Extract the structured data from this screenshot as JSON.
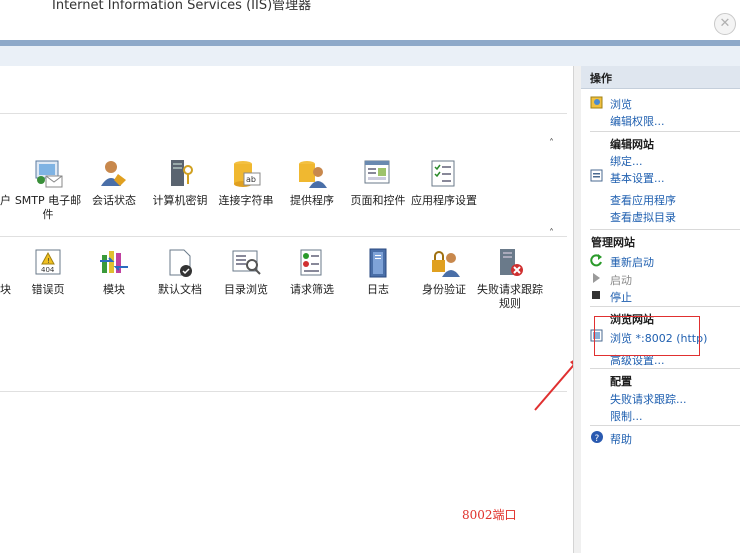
{
  "window": {
    "title": "Internet Information Services (IIS)管理器",
    "close_glyph": "✕"
  },
  "group1": {
    "partial_label": "户",
    "tiles": [
      {
        "label": "SMTP 电子邮件",
        "icon": "smtp-email-icon"
      },
      {
        "label": "会话状态",
        "icon": "session-state-icon"
      },
      {
        "label": "计算机密钥",
        "icon": "machine-key-icon"
      },
      {
        "label": "连接字符串",
        "icon": "connection-strings-icon"
      },
      {
        "label": "提供程序",
        "icon": "providers-icon"
      },
      {
        "label": "页面和控件",
        "icon": "pages-controls-icon"
      },
      {
        "label": "应用程序设置",
        "icon": "app-settings-icon"
      }
    ],
    "collapse_glyph": "˄"
  },
  "group2": {
    "partial_label": "块",
    "tiles": [
      {
        "label": "错误页",
        "icon": "error-pages-icon",
        "badge": "404"
      },
      {
        "label": "模块",
        "icon": "modules-icon"
      },
      {
        "label": "默认文档",
        "icon": "default-document-icon"
      },
      {
        "label": "目录浏览",
        "icon": "directory-browsing-icon"
      },
      {
        "label": "请求筛选",
        "icon": "request-filtering-icon"
      },
      {
        "label": "日志",
        "icon": "logging-icon"
      },
      {
        "label": "身份验证",
        "icon": "authentication-icon"
      },
      {
        "label": "失败请求跟踪规则",
        "icon": "failed-request-tracing-icon"
      }
    ],
    "collapse_glyph": "˄"
  },
  "annotation": "8002端口",
  "actions": {
    "header": "操作",
    "browse": "浏览",
    "edit_permissions": "编辑权限...",
    "edit_site_section": "编辑网站",
    "bindings": "绑定...",
    "basic_settings": "基本设置...",
    "view_applications": "查看应用程序",
    "view_virtual_dirs": "查看虚拟目录",
    "manage_site_section": "管理网站",
    "restart": "重新启动",
    "start": "启动",
    "stop": "停止",
    "browse_site_section": "浏览网站",
    "browse_port": "浏览 *:8002 (http)",
    "advanced_settings": "高级设置...",
    "config_section": "配置",
    "failed_request_tracing": "失败请求跟踪...",
    "limits": "限制...",
    "help": "帮助"
  },
  "colors": {
    "link": "#2060b0",
    "annotation": "#e0302a",
    "accent": "#8ea9c9"
  }
}
